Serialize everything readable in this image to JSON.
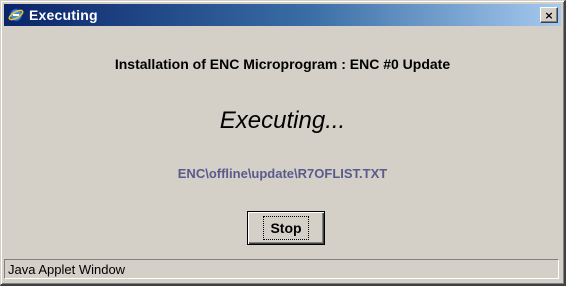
{
  "window": {
    "title": "Executing",
    "title_icon": "internet-explorer-icon",
    "close_label": "×"
  },
  "content": {
    "heading": "Installation of ENC Microprogram : ENC #0 Update",
    "status_message": "Executing...",
    "file_path": "ENC\\offline\\update\\R7OFLIST.TXT"
  },
  "actions": {
    "stop_label": "Stop"
  },
  "statusbar": {
    "text": "Java Applet Window"
  },
  "colors": {
    "titlebar_start": "#0a246a",
    "titlebar_end": "#a6caf0",
    "dialog_background": "#d4d0c8",
    "file_path_text": "#5a5a8c"
  }
}
